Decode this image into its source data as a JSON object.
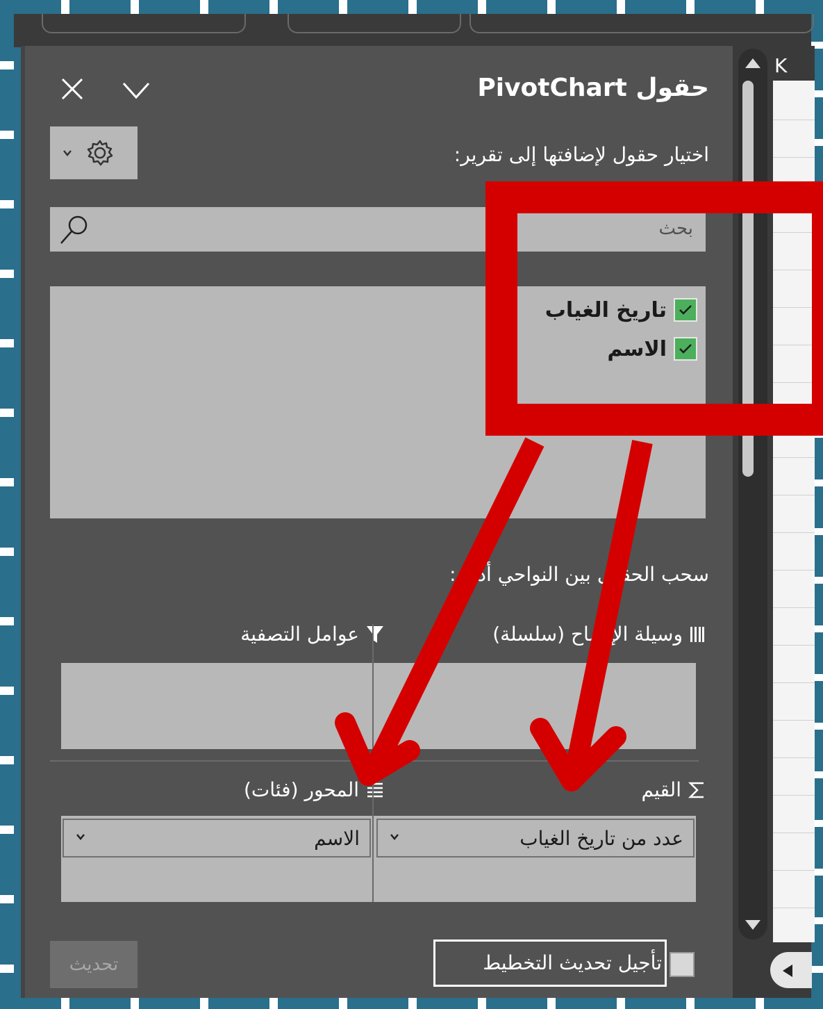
{
  "pane": {
    "title": "حقول PivotChart",
    "subtitle": "اختيار حقول لإضافتها إلى تقرير:",
    "search_placeholder": "بحث",
    "fields": [
      {
        "label": "تاريخ الغياب",
        "checked": true
      },
      {
        "label": "الاسم",
        "checked": true
      }
    ],
    "drag_label": "سحب الحقول بين النواحي أدناه:",
    "areas": {
      "legend": "وسيلة الإيضاح (سلسلة)",
      "filters": "عوامل التصفية",
      "values": "القيم",
      "axis": "المحور (فئات)"
    },
    "values_item": "عدد من تاريخ الغياب",
    "axis_item": "الاسم",
    "defer_label": "تأجيل تحديث التخطيط",
    "update_button": "تحديث"
  },
  "sheet": {
    "column_header": "K"
  },
  "icons": [
    "close-icon",
    "collapse-icon",
    "gear-icon",
    "search-icon",
    "funnel-icon",
    "legend-icon",
    "sigma-icon",
    "axis-icon",
    "checkmark-icon",
    "chevron-down-icon"
  ],
  "colors": {
    "pane_bg": "#525252",
    "box_bg": "#b8b8b8",
    "checkbox_green": "#4caf5c",
    "annotation_red": "#d40000"
  }
}
